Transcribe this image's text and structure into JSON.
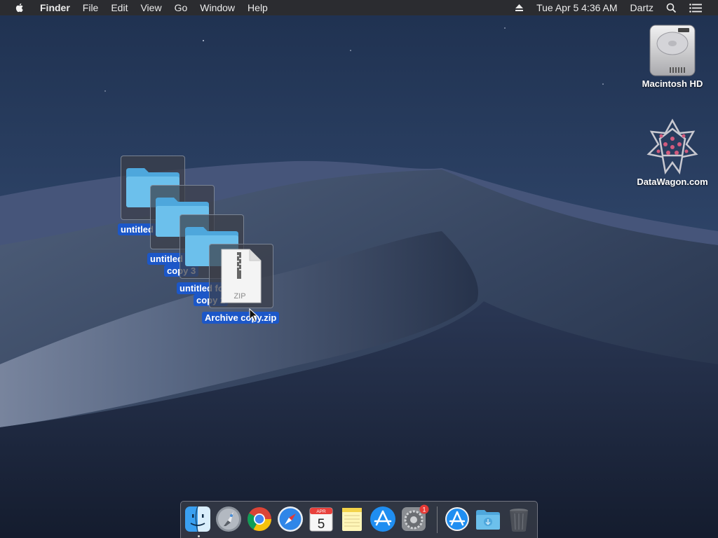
{
  "menubar": {
    "app_name": "Finder",
    "menus": [
      "File",
      "Edit",
      "View",
      "Go",
      "Window",
      "Help"
    ],
    "clock": "Tue Apr 5  4:36 AM",
    "user": "Dartz",
    "icons": [
      "apple-icon",
      "eject-icon",
      "spotlight-search-icon",
      "notification-center-icon"
    ]
  },
  "desktop_icons": [
    {
      "label": "Macintosh HD",
      "icon": "hard-drive-icon"
    },
    {
      "label": "DataWagon.com",
      "icon": "network-volume-icon"
    }
  ],
  "selected_items": [
    {
      "label_line1": "untitled",
      "label_line2": "",
      "icon": "folder-icon"
    },
    {
      "label_line1": "untitled folder",
      "label_line2": "copy 3",
      "icon": "folder-icon"
    },
    {
      "label_line1": "untitled folder",
      "label_line2": "copy 2",
      "icon": "folder-icon"
    },
    {
      "label_line1": "Archive copy.zip",
      "label_line2": "",
      "icon": "zip-file-icon",
      "badge": "ZIP"
    }
  ],
  "dock": {
    "items": [
      {
        "name": "Finder",
        "icon": "finder-icon"
      },
      {
        "name": "Launchpad",
        "icon": "launchpad-icon"
      },
      {
        "name": "Google Chrome",
        "icon": "chrome-icon"
      },
      {
        "name": "Safari",
        "icon": "safari-icon"
      },
      {
        "name": "Calendar",
        "icon": "calendar-icon",
        "month": "APR",
        "day": "5"
      },
      {
        "name": "Notes",
        "icon": "notes-icon"
      },
      {
        "name": "App Store",
        "icon": "app-store-icon"
      },
      {
        "name": "System Preferences",
        "icon": "system-preferences-icon",
        "badge": "1"
      },
      {
        "name": "Applications",
        "icon": "applications-folder-icon"
      },
      {
        "name": "Downloads",
        "icon": "downloads-folder-icon"
      },
      {
        "name": "Trash",
        "icon": "trash-icon"
      }
    ]
  },
  "colors": {
    "menubar": "#2b2c30",
    "selection_label": "#1c57c8",
    "folder": "#5ab4e6",
    "sky": "#1b2a45"
  }
}
